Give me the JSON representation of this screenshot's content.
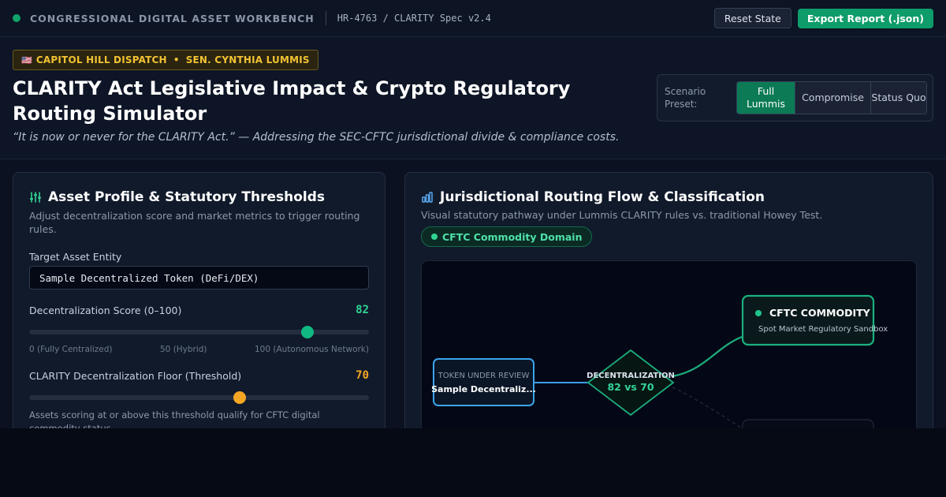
{
  "topbar": {
    "app_title": "CONGRESSIONAL DIGITAL ASSET WORKBENCH",
    "doc_id": "HR-4763 / CLARITY Spec v2.4",
    "reset_label": "Reset State",
    "export_label": "Export Report (.json)"
  },
  "hero": {
    "flag": "🇺🇸",
    "dispatch_source": "CAPITOL HILL DISPATCH",
    "dispatch_separator": "•",
    "dispatch_person": "SEN. CYNTHIA LUMMIS",
    "title": "CLARITY Act Legislative Impact & Crypto Regulatory Routing Simulator",
    "quote": "“It is now or never for the CLARITY Act.” — Addressing the SEC-CFTC jurisdictional divide & compliance costs."
  },
  "preset": {
    "label": "Scenario Preset:",
    "options": [
      {
        "label": "Full Lummis",
        "active": true
      },
      {
        "label": "Compromise",
        "active": false
      },
      {
        "label": "Status Quo",
        "active": false
      }
    ]
  },
  "asset_panel": {
    "icon": "sliders-icon",
    "title": "Asset Profile & Statutory Thresholds",
    "subtitle": "Adjust decentralization score and market metrics to trigger routing rules.",
    "entity_label": "Target Asset Entity",
    "entity_value": "Sample Decentralized Token (DeFi/DEX)",
    "score_label": "Decentralization Score (0–100)",
    "score_value": "82",
    "score_level": 82,
    "score_color": "#10b981",
    "scale_min": "0 (Fully Centralized)",
    "scale_mid": "50 (Hybrid)",
    "scale_max": "100 (Autonomous Network)",
    "threshold_label": "CLARITY Decentralization Floor (Threshold)",
    "threshold_value": "70",
    "threshold_level": 62,
    "threshold_color": "#f5a623",
    "threshold_help": "Assets scoring at or above this threshold qualify for CFTC digital commodity status."
  },
  "routing_panel": {
    "icon": "bar-chart-icon",
    "title": "Jurisdictional Routing Flow & Classification",
    "subtitle": "Visual statutory pathway under Lummis CLARITY rules vs. traditional Howey Test.",
    "domain_badge": "CFTC Commodity Domain",
    "flow": {
      "source_caption": "TOKEN UNDER REVIEW",
      "source_name": "Sample Decentraliz...",
      "decision_caption": "DECENTRALIZATION",
      "decision_value": "82 vs 70",
      "target_title": "CFTC COMMODITY",
      "target_subtitle": "Spot Market Regulatory Sandbox"
    }
  }
}
